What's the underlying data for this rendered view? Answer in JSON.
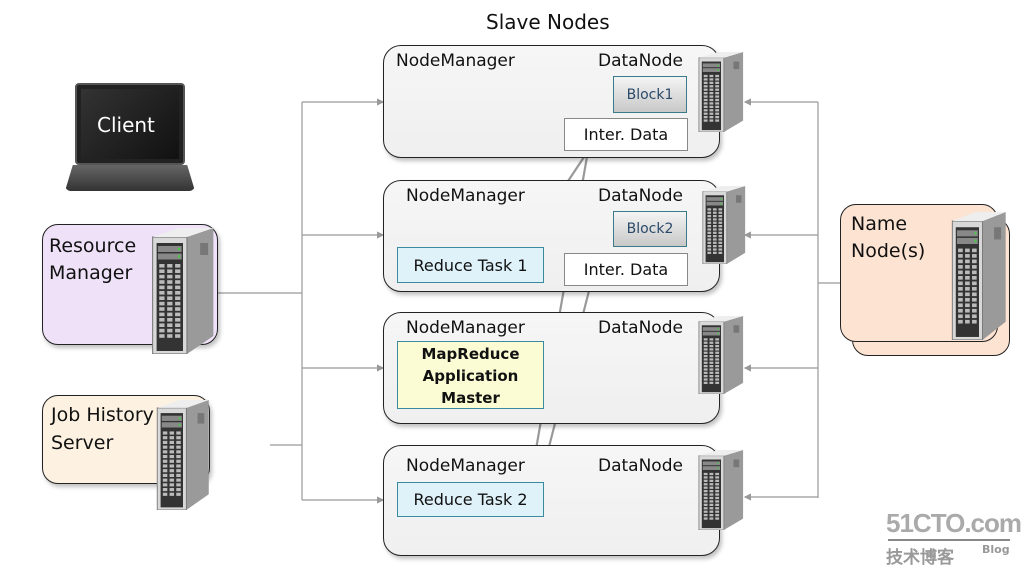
{
  "title": "Slave Nodes",
  "client": {
    "label": "Client"
  },
  "resource_manager": {
    "label_line1": "Resource",
    "label_line2": "Manager",
    "color": "#efe2f8"
  },
  "job_history": {
    "label_line1": "Job History",
    "label_line2": "Server",
    "color": "#fdf1e2"
  },
  "name_node": {
    "label_line1": "Name",
    "label_line2": "Node(s)",
    "color": "#fde3d2"
  },
  "slave_nodes": [
    {
      "node_manager": "NodeManager",
      "data_node": "DataNode",
      "block": "Block1",
      "inter_data": "Inter. Data"
    },
    {
      "node_manager": "NodeManager",
      "data_node": "DataNode",
      "block": "Block2",
      "inter_data": "Inter. Data",
      "task": "Reduce Task 1"
    },
    {
      "node_manager": "NodeManager",
      "data_node": "DataNode",
      "app_master": [
        "MapReduce",
        "Application",
        "Master"
      ]
    },
    {
      "node_manager": "NodeManager",
      "data_node": "DataNode",
      "task": "Reduce Task 2"
    }
  ],
  "watermark": {
    "main": "51CTO.com",
    "sub": "技术博客",
    "blog": "Blog"
  }
}
